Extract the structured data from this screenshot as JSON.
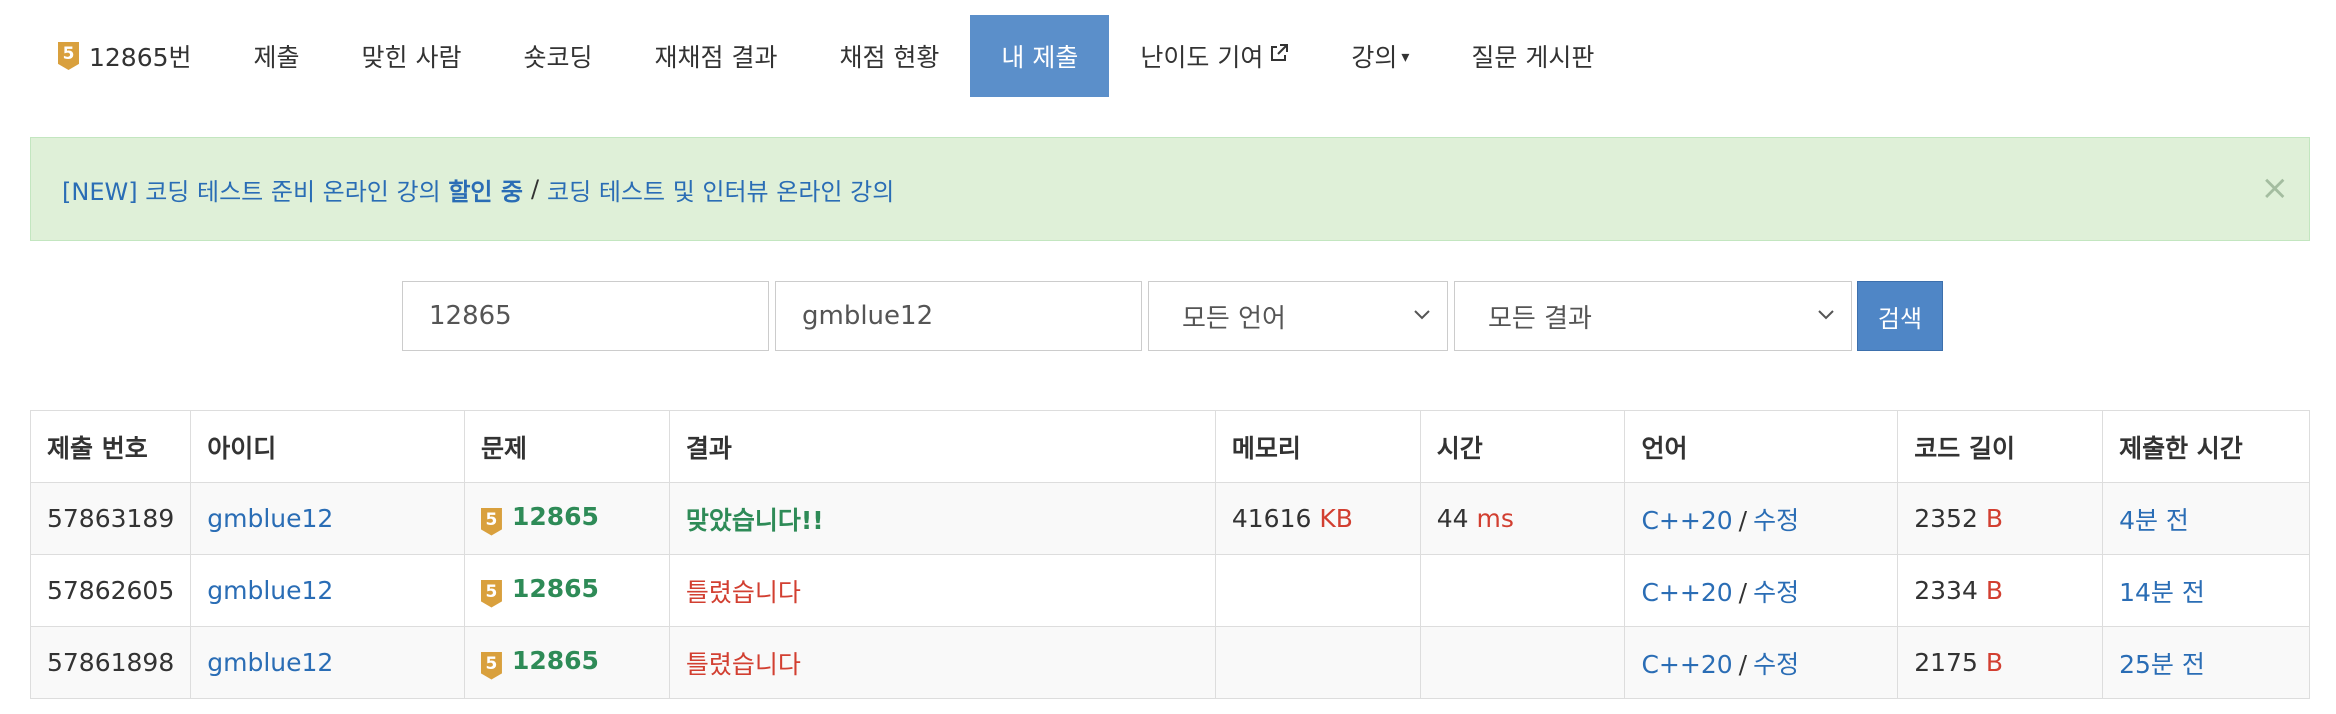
{
  "nav": {
    "problem_tier": "5",
    "items": [
      "12865번",
      "제출",
      "맞힌 사람",
      "숏코딩",
      "재채점 결과",
      "채점 현황",
      "내 제출",
      "난이도 기여",
      "강의",
      "질문 게시판"
    ]
  },
  "alert": {
    "prefix": "[NEW] 코딩 테스트 준비 온라인 강의",
    "bold": "할인 중",
    "separator": "/",
    "link2": "코딩 테스트 및 인터뷰 온라인 강의",
    "close": "×"
  },
  "search": {
    "problem_id": "12865",
    "user_id": "gmblue12",
    "language": "모든 언어",
    "result": "모든 결과",
    "button": "검색"
  },
  "table": {
    "headers": [
      "제출 번호",
      "아이디",
      "문제",
      "결과",
      "메모리",
      "시간",
      "언어",
      "코드 길이",
      "제출한 시간"
    ],
    "rows": [
      {
        "id": "57863189",
        "user": "gmblue12",
        "tier": "5",
        "problem": "12865",
        "result": "맞았습니다!!",
        "memory": "41616",
        "memory_unit": "KB",
        "time": "44",
        "time_unit": "ms",
        "lang": "C++20",
        "edit": "수정",
        "code_len": "2352",
        "len_unit": "B",
        "submitted": "4분 전"
      },
      {
        "id": "57862605",
        "user": "gmblue12",
        "tier": "5",
        "problem": "12865",
        "result": "틀렸습니다",
        "memory": "",
        "memory_unit": "",
        "time": "",
        "time_unit": "",
        "lang": "C++20",
        "edit": "수정",
        "code_len": "2334",
        "len_unit": "B",
        "submitted": "14분 전"
      },
      {
        "id": "57861898",
        "user": "gmblue12",
        "tier": "5",
        "problem": "12865",
        "result": "틀렸습니다",
        "memory": "",
        "memory_unit": "",
        "time": "",
        "time_unit": "",
        "lang": "C++20",
        "edit": "수정",
        "code_len": "2175",
        "len_unit": "B",
        "submitted": "25분 전"
      }
    ]
  }
}
